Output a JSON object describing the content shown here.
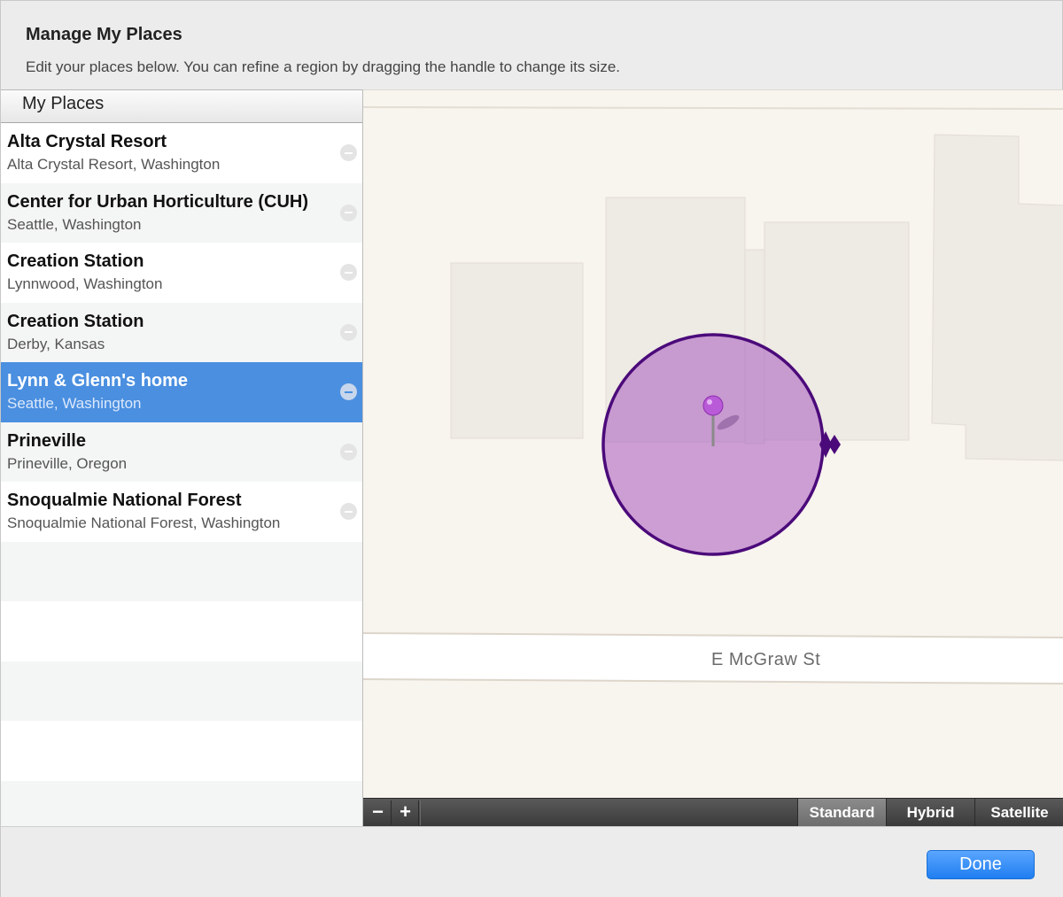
{
  "dialog": {
    "title": "Manage My Places",
    "subtitle": "Edit your places below. You can refine a region by dragging the handle to change its size."
  },
  "list": {
    "header": "My Places",
    "selected_index": 4,
    "items": [
      {
        "name": "Alta Crystal Resort",
        "location": "Alta Crystal Resort, Washington"
      },
      {
        "name": "Center for Urban Horticulture (CUH)",
        "location": "Seattle, Washington"
      },
      {
        "name": "Creation Station",
        "location": "Lynnwood, Washington"
      },
      {
        "name": "Creation Station",
        "location": "Derby, Kansas"
      },
      {
        "name": "Lynn & Glenn's home",
        "location": "Seattle, Washington"
      },
      {
        "name": "Prineville",
        "location": "Prineville, Oregon"
      },
      {
        "name": "Snoqualmie National Forest",
        "location": "Snoqualmie National Forest, Washington"
      }
    ]
  },
  "map": {
    "street_label": "E McGraw St",
    "region_color": "#a757c0",
    "region_border_color": "#4b0a7a",
    "pin_color": "#b95ad8"
  },
  "toolbar": {
    "zoom_out": "−",
    "zoom_in": "+",
    "modes": [
      "Standard",
      "Hybrid",
      "Satellite"
    ],
    "active_mode": "Standard"
  },
  "footer": {
    "done_label": "Done"
  },
  "colors": {
    "selection": "#4a8fe0",
    "primary_button": "#1f7ef0"
  }
}
